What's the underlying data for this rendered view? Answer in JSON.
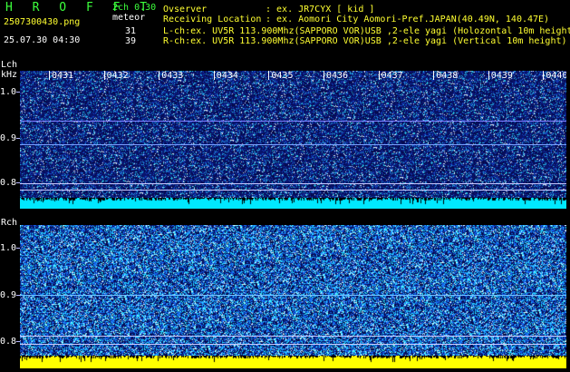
{
  "header": {
    "app_title": "H R O F F T",
    "file_name": "2507300430.png",
    "timestamp": "25.07.30 04:30",
    "mode": "2ch 0.30",
    "meteor_label": "meteor",
    "lch_count": "31",
    "rch_count": "39",
    "observer_label": "Ovserver",
    "observer_value": ": ex. JR7CYX [ kid ]",
    "location_label": "Receiving Location",
    "location_value": ": ex. Aomori City Aomori-Pref.JAPAN(40.49N, 140.47E)",
    "lch_info": "L-ch:ex. UV5R 113.900Mhz(SAPPORO VOR)USB ,2-ele yagi (Holozontal 10m height)",
    "rch_info": "R-ch:ex. UV5R 113.900Mhz(SAPPORO VOR)USB ,2-ele yagi (Vertical 10m height)"
  },
  "panels": {
    "lch": {
      "label": "Lch",
      "unit": "kHz"
    },
    "rch": {
      "label": "Rch"
    }
  },
  "y_ticks": [
    "1.0",
    "0.9",
    "0.8"
  ],
  "time_ticks": [
    "0431",
    "0432",
    "0433",
    "0434",
    "0435",
    "0436",
    "0437",
    "0438",
    "0439",
    "0440"
  ],
  "colors": {
    "header_green": "#3cff3c",
    "header_yellow": "#ffff30",
    "lch_bar": "#00e8ff",
    "rch_bar": "#ffff00",
    "background_blue": "#10208a"
  }
}
